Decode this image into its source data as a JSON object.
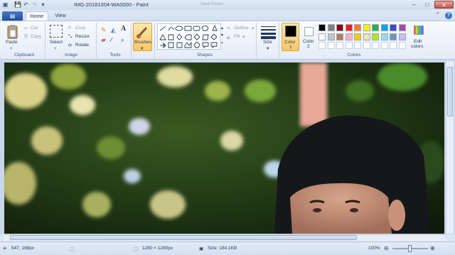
{
  "window": {
    "title": "IMG-20181004-WA0000 - Paint",
    "faint_text": "Save Folder",
    "min": "–",
    "max": "□",
    "close": "✕"
  },
  "quick_access": {
    "save": "💾",
    "undo": "↶",
    "redo": "↷",
    "menu": "▾"
  },
  "tabs": {
    "file": "▤",
    "home": "Home",
    "view": "View",
    "help": "?",
    "collapse": "^"
  },
  "clipboard": {
    "paste": "Paste",
    "cut": "Cut",
    "copy": "Copy",
    "group": "Clipboard"
  },
  "image": {
    "select": "Select",
    "crop": "Crop",
    "resize": "Resize",
    "rotate": "Rotate",
    "group": "Image"
  },
  "tools": {
    "group": "Tools"
  },
  "brushes": {
    "label": "Brushes"
  },
  "shapes": {
    "outline": "Outline",
    "fill": "Fill",
    "group": "Shapes"
  },
  "size": {
    "label": "Size"
  },
  "colors": {
    "color1_label": "Color",
    "color1_num": "1",
    "color2_label": "Color",
    "color2_num": "2",
    "edit_label": "Edit",
    "edit_label2": "colors",
    "group": "Colors",
    "color1": "#000000",
    "color2": "#ffffff",
    "palette_row1": [
      "#000000",
      "#7f7f7f",
      "#880015",
      "#ed1c24",
      "#ff7f27",
      "#fff200",
      "#22b14c",
      "#00a2e8",
      "#3f48cc",
      "#a349a4"
    ],
    "palette_row2": [
      "#ffffff",
      "#c3c3c3",
      "#b97a57",
      "#ffaec9",
      "#ffc90e",
      "#efe4b0",
      "#b5e61d",
      "#99d9ea",
      "#7092be",
      "#c8bfe7"
    ]
  },
  "status": {
    "position": "547, 168px",
    "dimensions": "1280 × 1280px",
    "size": "Size: 184.1KB",
    "zoom": "100%",
    "zoom_minus": "⊖",
    "zoom_plus": "⊕"
  }
}
